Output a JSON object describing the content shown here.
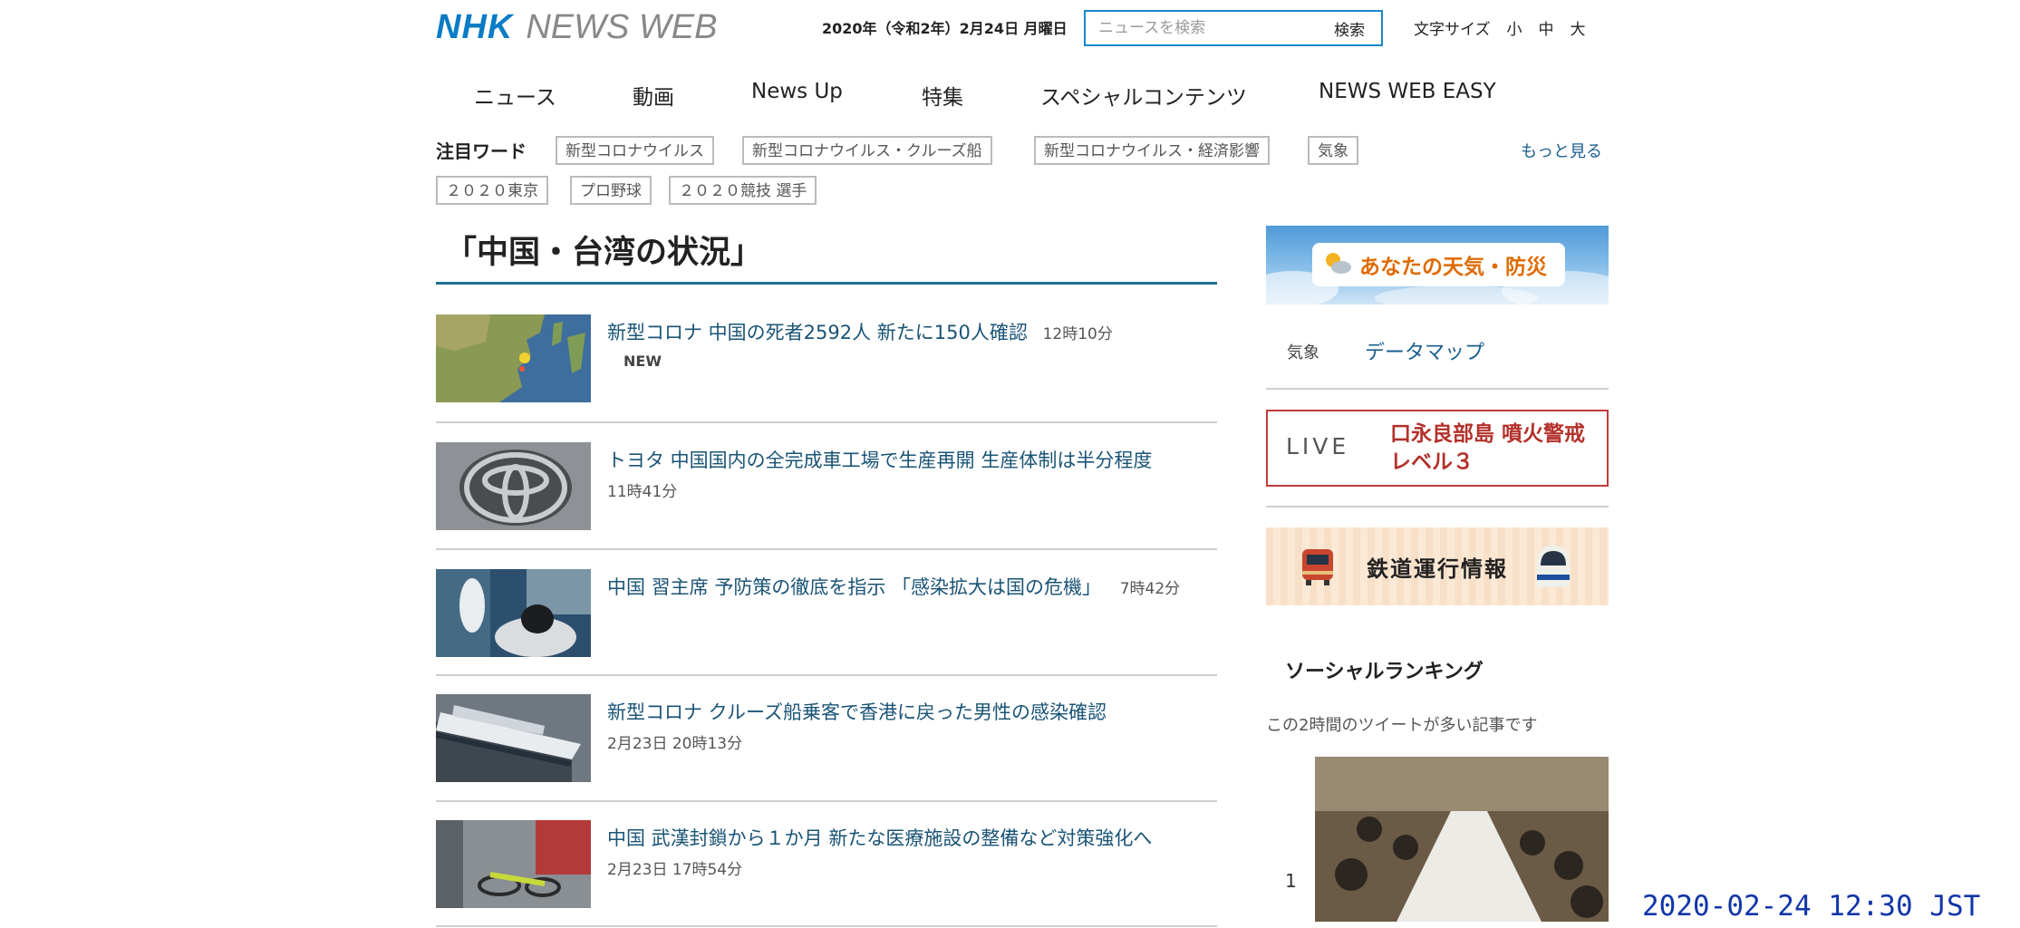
{
  "header": {
    "logo_nhk": "NHK",
    "logo_web": "NEWS WEB",
    "date": "2020年（令和2年）2月24日 月曜日",
    "search_placeholder": "ニュースを検索",
    "search_button": "検索",
    "fontsize_label": "文字サイズ",
    "fontsize_small": "小",
    "fontsize_medium": "中",
    "fontsize_large": "大"
  },
  "nav": {
    "items": [
      "ニュース",
      "動画",
      "News Up",
      "特集",
      "スペシャルコンテンツ",
      "NEWS WEB EASY"
    ]
  },
  "trending": {
    "label": "注目ワード",
    "tags": [
      "新型コロナウイルス",
      "新型コロナウイルス・クルーズ船",
      "新型コロナウイルス・経済影響",
      "気象",
      "２０２０東京",
      "プロ野球",
      "２０２０競技 選手"
    ],
    "more": "もっと見る"
  },
  "section": {
    "title": "「中国・台湾の状況」"
  },
  "articles": [
    {
      "headline": "新型コロナ 中国の死者2592人 新たに150人確認",
      "time": "12時10分",
      "badge": "NEW"
    },
    {
      "headline": "トヨタ 中国国内の全完成車工場で生産再開 生産体制は半分程度",
      "time": "11時41分"
    },
    {
      "headline": "中国 習主席 予防策の徹底を指示 「感染拡大は国の危機」",
      "time": "7時42分"
    },
    {
      "headline": "新型コロナ クルーズ船乗客で香港に戻った男性の感染確認",
      "time": "2月23日 20時13分"
    },
    {
      "headline": "中国 武漢封鎖から１か月 新たな医療施設の整備など対策強化へ",
      "time": "2月23日 17時54分"
    }
  ],
  "sidebar": {
    "weather_banner": "あなたの天気・防災",
    "weather_link": "気象",
    "datamap_link": "データマップ",
    "live_label": "LIVE",
    "live_text": "口永良部島 噴火警戒レベル３",
    "rail_banner": "鉄道運行情報",
    "social_title": "ソーシャルランキング",
    "social_subtitle": "この2時間のツイートが多い記事です",
    "rank_number": "1"
  },
  "overlay": {
    "timestamp": "2020-02-24 12:30 JST"
  },
  "colors": {
    "brand_blue": "#0a7cc6",
    "link_blue": "#1a5476",
    "section_rule": "#1f6f8e",
    "live_red": "#c23b3b",
    "weather_orange": "#e06a00",
    "timestamp_blue": "#1236a8"
  },
  "icons": [
    "sun-cloud-icon",
    "train-red-icon",
    "train-shinkansen-icon"
  ]
}
